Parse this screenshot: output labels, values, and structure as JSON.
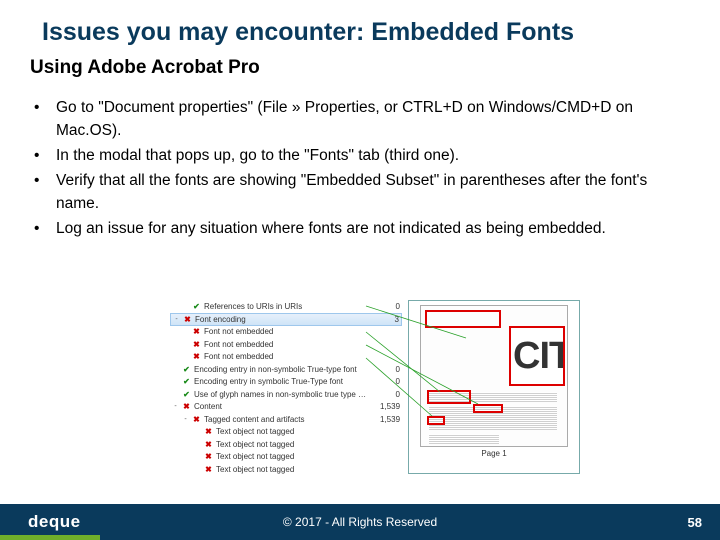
{
  "title": "Issues you may encounter: Embedded Fonts",
  "subtitle": "Using Adobe Acrobat Pro",
  "bullets": [
    "Go to \"Document properties\" (File » Properties, or CTRL+D on Windows/CMD+D on Mac.OS).",
    "In the modal that pops up, go to the \"Fonts\" tab (third one).",
    "Verify that all the fonts are showing \"Embedded Subset\" in parentheses after the font's name.",
    "Log an issue for any situation where fonts are not indicated as being embedded."
  ],
  "tree": [
    {
      "status": "ok",
      "lvl": 1,
      "label": "References to URIs in URIs",
      "count": "0"
    },
    {
      "status": "bad",
      "lvl": 0,
      "collapse": "-",
      "label": "Font encoding",
      "count": "3",
      "selected": true
    },
    {
      "status": "bad",
      "lvl": 1,
      "label": "Font not embedded",
      "count": ""
    },
    {
      "status": "bad",
      "lvl": 1,
      "label": "Font not embedded",
      "count": ""
    },
    {
      "status": "bad",
      "lvl": 1,
      "label": "Font not embedded",
      "count": ""
    },
    {
      "status": "ok",
      "lvl": 0,
      "label": "Encoding entry in non-symbolic True-type font",
      "count": "0"
    },
    {
      "status": "ok",
      "lvl": 0,
      "label": "Encoding entry in symbolic True-Type font",
      "count": "0"
    },
    {
      "status": "ok",
      "lvl": 0,
      "label": "Use of glyph names in non-symbolic true type …",
      "count": "0"
    },
    {
      "status": "bad",
      "lvl": 0,
      "collapse": "-",
      "label": "Content",
      "count": "1,539"
    },
    {
      "status": "bad",
      "lvl": 1,
      "collapse": "-",
      "label": "Tagged content and artifacts",
      "count": "1,539"
    },
    {
      "status": "bad",
      "lvl": 2,
      "label": "Text object not tagged",
      "count": ""
    },
    {
      "status": "bad",
      "lvl": 2,
      "label": "Text object not tagged",
      "count": ""
    },
    {
      "status": "bad",
      "lvl": 2,
      "label": "Text object not tagged",
      "count": ""
    },
    {
      "status": "bad",
      "lvl": 2,
      "label": "Text object not tagged",
      "count": ""
    }
  ],
  "preview": {
    "bigtext": "CIT",
    "pagelabel": "Page 1"
  },
  "footer": {
    "logo": "deque",
    "copyright": "© 2017 - All Rights Reserved",
    "pagenum": "58"
  }
}
